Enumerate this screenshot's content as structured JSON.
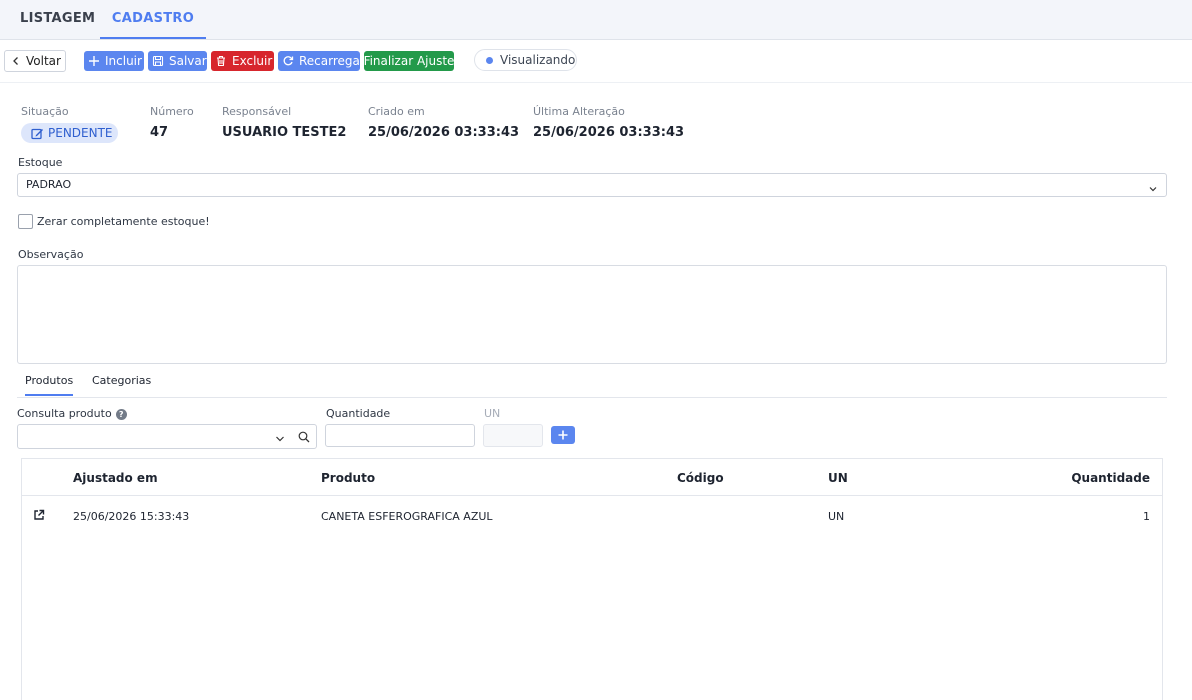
{
  "tabs": {
    "list": "LISTAGEM",
    "form": "CADASTRO"
  },
  "toolbar": {
    "voltar": "Voltar",
    "incluir": "Incluir",
    "salvar": "Salvar",
    "excluir": "Excluir",
    "recarrega": "Recarrega",
    "finalizar": "Finalizar Ajuste",
    "mode": "Visualizando"
  },
  "info": {
    "situacao_label": "Situação",
    "situacao_value": "PENDENTE",
    "numero_label": "Número",
    "numero_value": "47",
    "responsavel_label": "Responsável",
    "responsavel_value": "USUARIO TESTE2",
    "criado_label": "Criado em",
    "criado_value": "25/06/2026 03:33:43",
    "alteracao_label": "Última Alteração",
    "alteracao_value": "25/06/2026 03:33:43"
  },
  "form": {
    "estoque_label": "Estoque",
    "estoque_value": "PADRAO",
    "zerar_label": "Zerar completamente estoque!",
    "zerar_checked": false,
    "observacao_label": "Observação",
    "observacao_value": ""
  },
  "subtabs": {
    "produtos": "Produtos",
    "categorias": "Categorias"
  },
  "product_entry": {
    "consulta_label": "Consulta produto",
    "quantidade_label": "Quantidade",
    "un_label": "UN"
  },
  "table": {
    "headers": {
      "ajustado": "Ajustado em",
      "produto": "Produto",
      "codigo": "Código",
      "un": "UN",
      "quantidade": "Quantidade"
    },
    "rows": [
      {
        "ajustado": "25/06/2026 15:33:43",
        "produto": "CANETA ESFEROGRAFICA AZUL",
        "codigo": "",
        "un": "UN",
        "quantidade": "1"
      }
    ]
  },
  "colors": {
    "primary": "#5b86ef",
    "danger": "#d7262d",
    "success": "#239a4a",
    "pill_bg": "#dde6fb"
  }
}
